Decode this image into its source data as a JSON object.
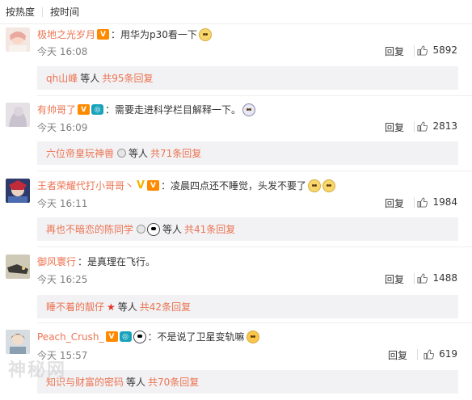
{
  "sort": {
    "hot": "按热度",
    "time": "按时间"
  },
  "comments": [
    {
      "user": "极地之光岁月",
      "text": "：用华为p30看一下",
      "time": "今天 16:08",
      "reply_label": "回复",
      "likes": "5892",
      "sub": {
        "name": "qh山峰",
        "rest": "等人",
        "count": "共95条回复"
      }
    },
    {
      "user": "有帅哥了",
      "text": "：需要走进科学栏目解释一下。",
      "time": "今天 16:09",
      "reply_label": "回复",
      "likes": "2813",
      "sub": {
        "name": "六位帝皇玩神兽",
        "rest": "等人",
        "count": "共71条回复"
      }
    },
    {
      "user": "王者荣耀代打小哥哥丶",
      "text": "：凌晨四点还不睡觉，头发不要了",
      "time": "今天 16:11",
      "reply_label": "回复",
      "likes": "1984",
      "sub": {
        "name": "再也不暗恋的陈同学",
        "rest": "等人",
        "count": "共41条回复"
      }
    },
    {
      "user": "御风寰行",
      "text": "：是真理在飞行。",
      "time": "今天 16:25",
      "reply_label": "回复",
      "likes": "1488",
      "sub": {
        "name": "睡不着的靓仔",
        "rest": "等人",
        "count": "共42条回复"
      }
    },
    {
      "user": "Peach_Crush_",
      "text": "：不是说了卫星变轨嘛",
      "time": "今天 15:57",
      "reply_label": "回复",
      "likes": "619",
      "sub": {
        "name": "知识与财富的密码",
        "rest": "等人",
        "count": "共70条回复"
      }
    }
  ],
  "icons": {
    "like": "thumbs-up-icon",
    "vip": "vip-badge-icon",
    "member": "member-badge-icon",
    "verified": "verified-v-icon",
    "medal": "medal-icon",
    "star": "star-icon",
    "emoji": "emoji-icon"
  },
  "colors": {
    "username": "#eb7350",
    "time": "#808080",
    "subreply_bg": "#f2f2f5"
  },
  "watermark": "神秘网"
}
